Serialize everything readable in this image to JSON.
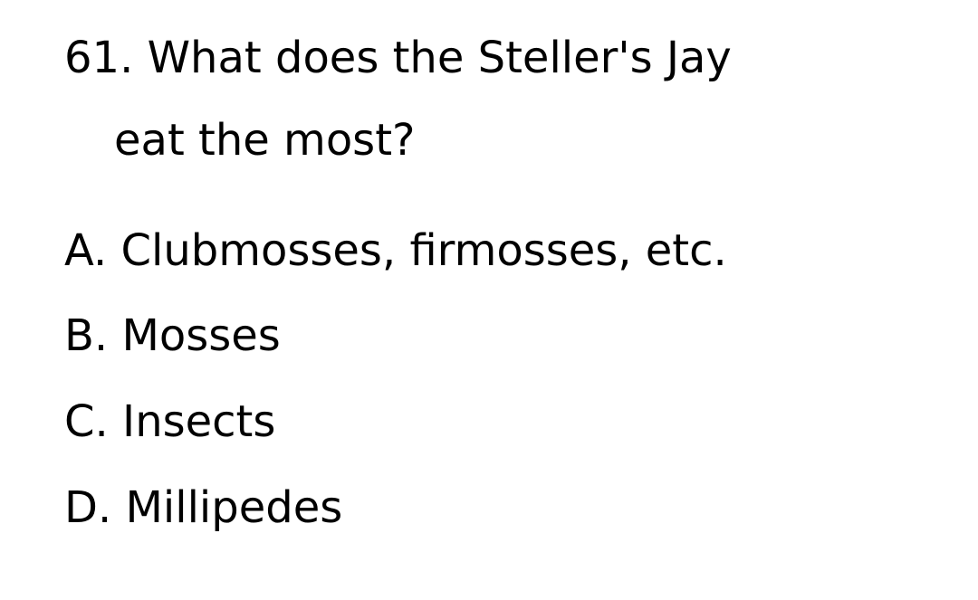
{
  "question": {
    "line1": "61. What does the Steller's Jay",
    "line2": "eat the most?"
  },
  "options": [
    {
      "text": "A. Clubmosses, firmosses, etc."
    },
    {
      "text": "B. Mosses"
    },
    {
      "text": "C. Insects"
    },
    {
      "text": "D. Millipedes"
    }
  ]
}
